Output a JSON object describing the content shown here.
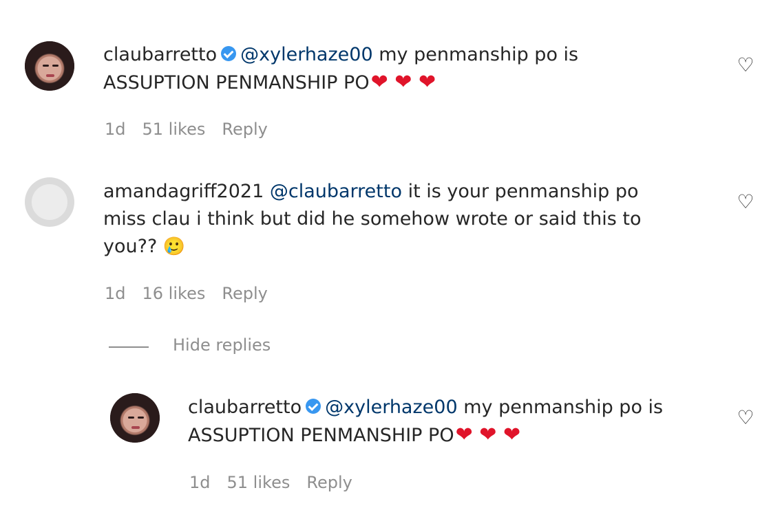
{
  "comments": [
    {
      "username": "claubarretto",
      "mention": "@xylerhaze00",
      "line1": "my penmanship po is",
      "line2": "ASSUPTION PENMANSHIP PO",
      "emoji": "❤ ❤ ❤",
      "time": "1d",
      "likes": "51 likes",
      "reply": "Reply"
    },
    {
      "username": "amandagriff2021",
      "mention": "@claubarretto",
      "line1": "it is your penmanship po",
      "line2": "miss clau i think but did he somehow wrote or said this to",
      "line3": "you??",
      "emoji": "🥲",
      "time": "1d",
      "likes": "16 likes",
      "reply": "Reply"
    },
    {
      "username": "claubarretto",
      "mention": "@xylerhaze00",
      "line1": "my penmanship po is",
      "line2": "ASSUPTION PENMANSHIP PO",
      "emoji": "❤ ❤ ❤",
      "time": "1d",
      "likes": "51 likes",
      "reply": "Reply"
    }
  ],
  "thread": {
    "hide_replies": "Hide replies"
  },
  "icons": {
    "like": "heart-outline-icon",
    "verified": "verified-badge-icon"
  },
  "colors": {
    "mention": "#00376b",
    "verified": "#3897f0",
    "muted": "#8e8e8e",
    "heart": "#e0142a"
  }
}
